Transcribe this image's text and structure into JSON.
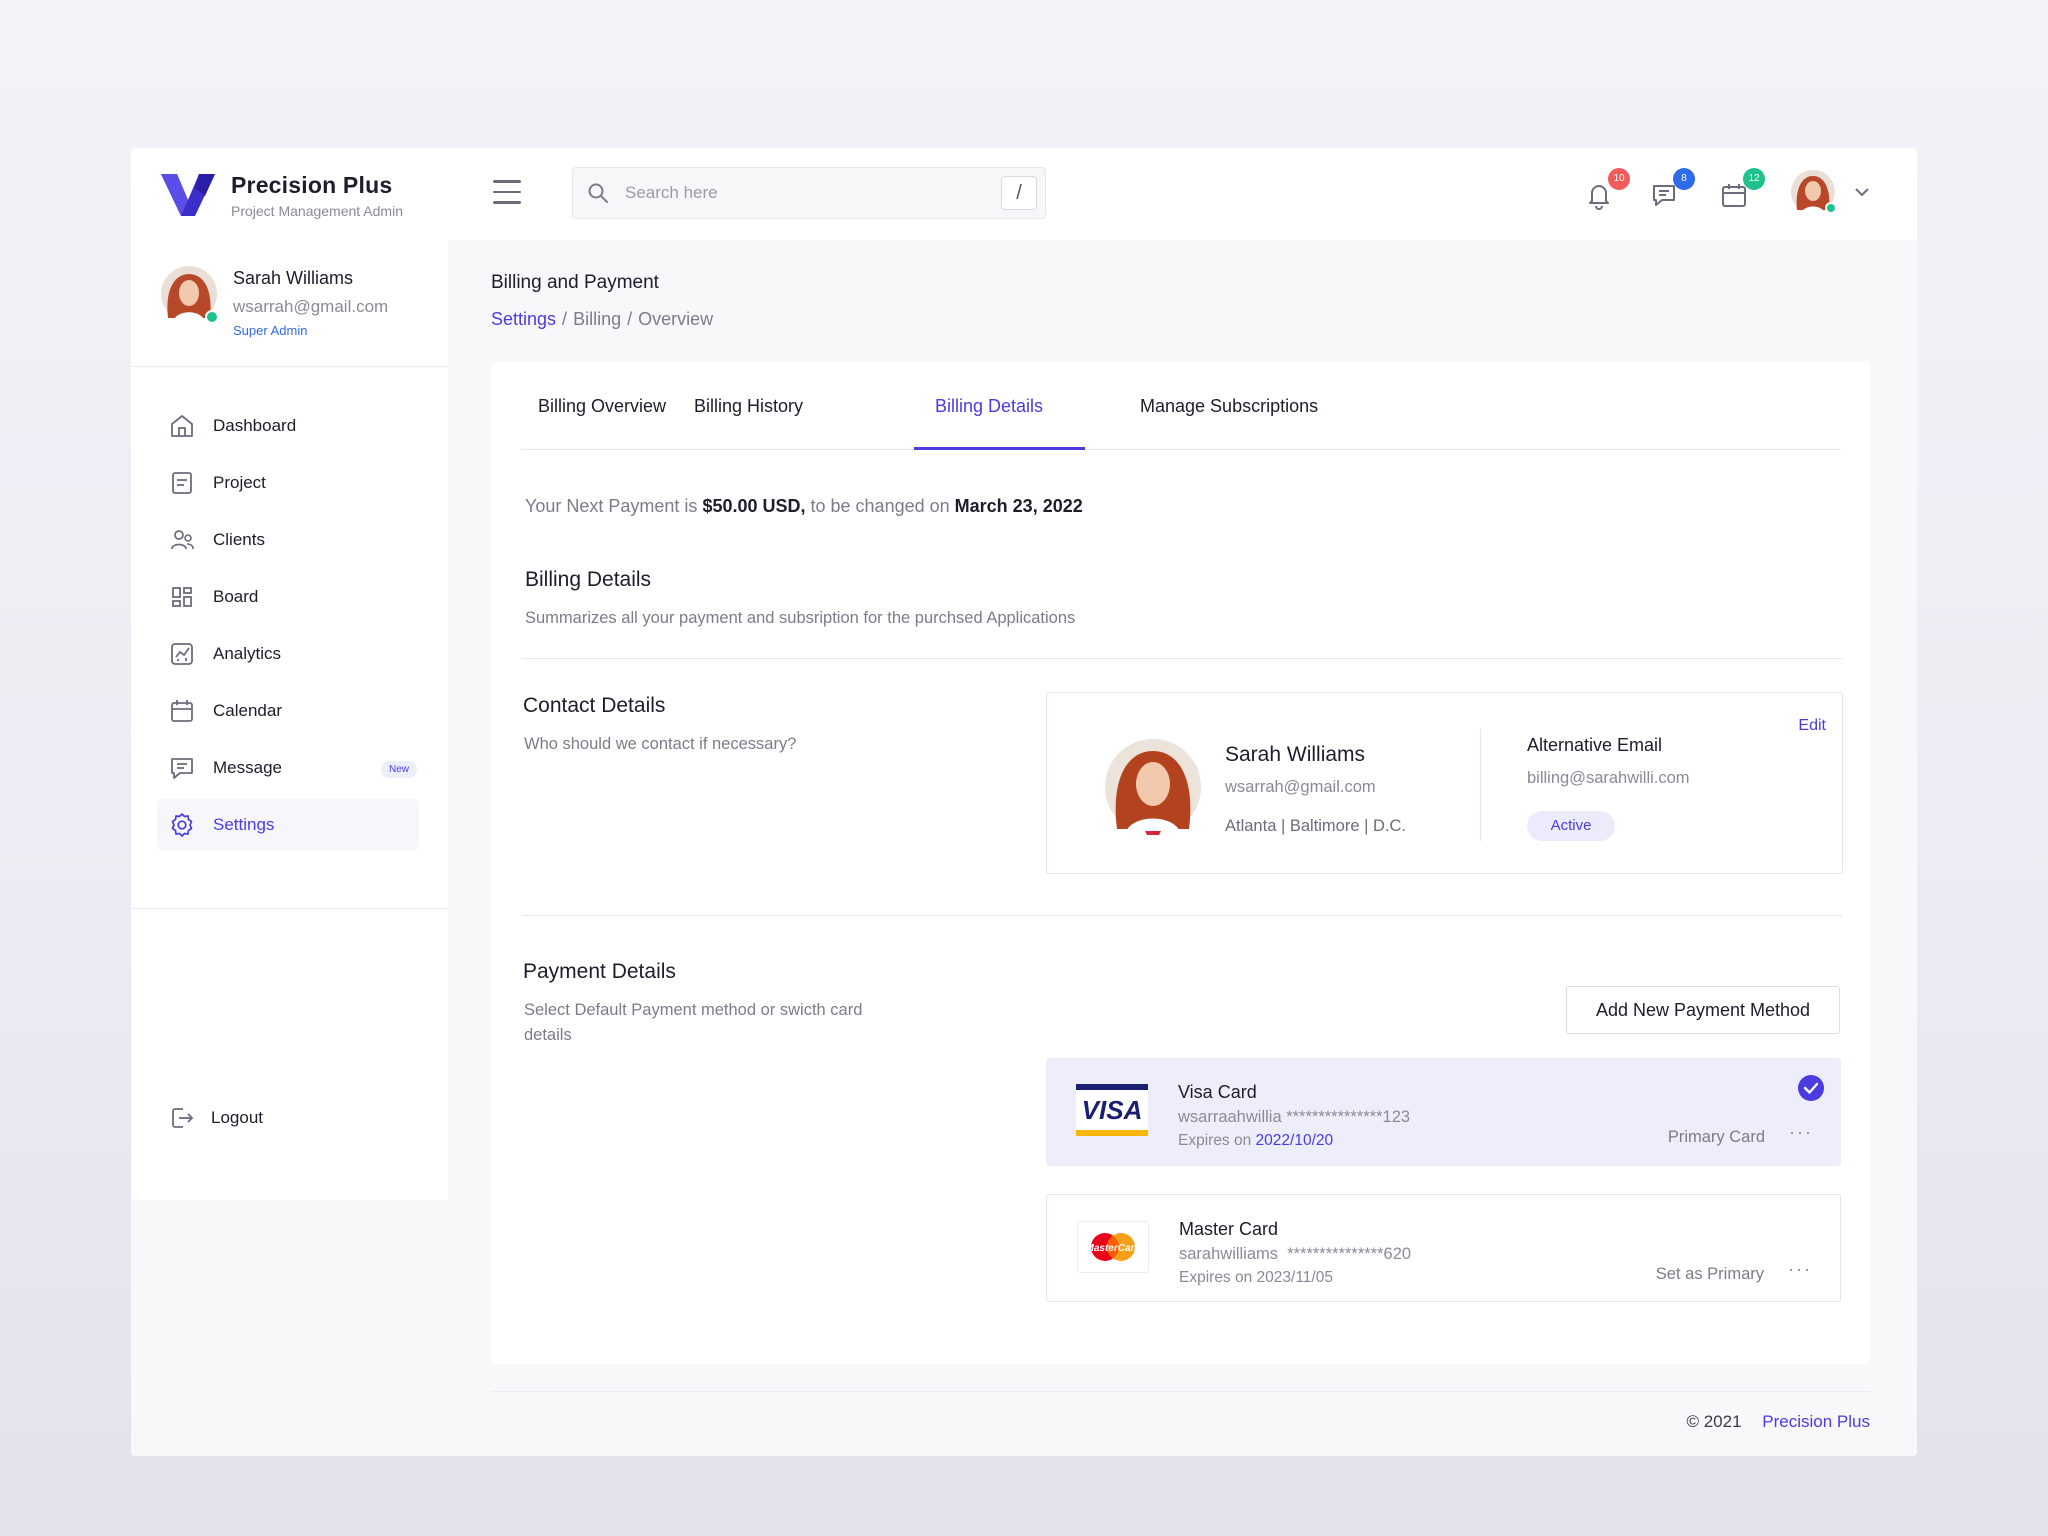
{
  "brand": {
    "name": "Precision Plus",
    "subtitle": "Project Management Admin"
  },
  "search": {
    "placeholder": "Search here",
    "shortcut": "/"
  },
  "header_icons": [
    {
      "name": "bell-icon",
      "badge": "10",
      "badge_color": "#f25b5b"
    },
    {
      "name": "chat-icon",
      "badge": "8",
      "badge_color": "#2f6be8"
    },
    {
      "name": "calendar-icon",
      "badge": "12",
      "badge_color": "#1fc28c"
    }
  ],
  "profile": {
    "name": "Sarah Williams",
    "email": "wsarrah@gmail.com",
    "role": "Super Admin"
  },
  "nav": [
    {
      "label": "Dashboard",
      "icon": "home-icon"
    },
    {
      "label": "Project",
      "icon": "document-icon"
    },
    {
      "label": "Clients",
      "icon": "users-icon"
    },
    {
      "label": "Board",
      "icon": "grid-icon"
    },
    {
      "label": "Analytics",
      "icon": "chart-icon"
    },
    {
      "label": "Calendar",
      "icon": "calendar-icon"
    },
    {
      "label": "Message",
      "icon": "message-icon",
      "badge": "New"
    },
    {
      "label": "Settings",
      "icon": "gear-icon",
      "active": true
    }
  ],
  "logout_label": "Logout",
  "page": {
    "title": "Billing and Payment",
    "breadcrumb": [
      "Settings",
      "Billing",
      "Overview"
    ]
  },
  "tabs": [
    {
      "label": "Billing Overview"
    },
    {
      "label": "Billing History"
    },
    {
      "label": "Billing Details",
      "active": true
    },
    {
      "label": "Manage Subscriptions"
    }
  ],
  "next_payment": {
    "prefix": "Your Next Payment is",
    "amount": "$50.00 USD,",
    "middle": "to be changed on",
    "date": "March 23, 2022"
  },
  "billing_details": {
    "title": "Billing Details",
    "description": "Summarizes all your payment and subsription for the purchsed Applications"
  },
  "contact_details": {
    "title": "Contact Details",
    "description": "Who should we contact if necessary?",
    "name": "Sarah Williams",
    "email": "wsarrah@gmail.com",
    "location": "Atlanta | Baltimore | D.C.",
    "alt_email_title": "Alternative Email",
    "alt_email": "billing@sarahwilli.com",
    "status": "Active",
    "edit_label": "Edit"
  },
  "payment_details": {
    "title": "Payment Details",
    "description_line1": "Select Default Payment method or swicth card",
    "description_line2": "details",
    "add_button": "Add New Payment Method",
    "cards": [
      {
        "name": "Visa Card",
        "holder": "wsarraahwillia",
        "masked": "***************123",
        "expires_label": "Expires on",
        "expires": "2022/10/20",
        "status": "Primary Card",
        "more": "···"
      },
      {
        "name": "Master Card",
        "holder": "sarahwilliams",
        "masked": "***************620",
        "expires_label": "Expires on",
        "expires": "2023/11/05",
        "status": "Set as Primary",
        "more": "···"
      }
    ]
  },
  "footer": {
    "copyright": "© 2021",
    "brand": "Precision Plus"
  },
  "colors": {
    "accent": "#4a3ce0",
    "success": "#1fc28c",
    "danger": "#f25b5b",
    "info": "#2f6be8"
  }
}
